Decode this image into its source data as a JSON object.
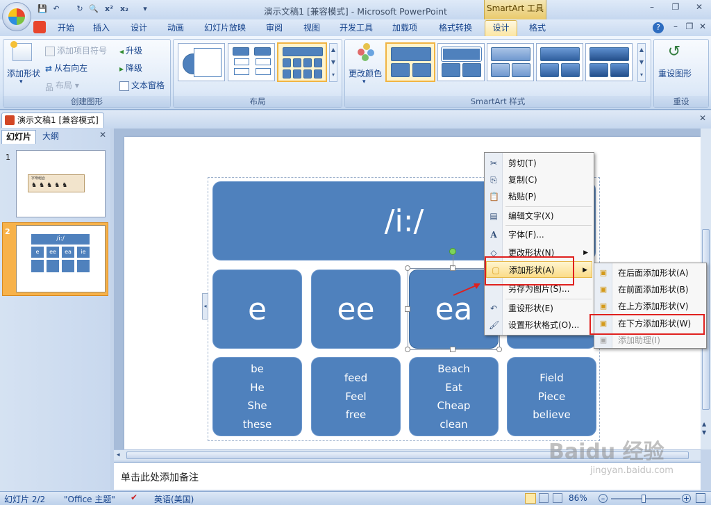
{
  "window": {
    "title": "演示文稿1 [兼容模式] - Microsoft PowerPoint",
    "contextual_tab_group": "SmartArt 工具"
  },
  "tabs": [
    "开始",
    "插入",
    "设计",
    "动画",
    "幻灯片放映",
    "审阅",
    "视图",
    "开发工具",
    "加载项",
    "格式转换",
    "设计",
    "格式"
  ],
  "ribbon": {
    "create_graphic": {
      "label": "创建图形",
      "add_shape": "添加形状",
      "add_bullet": "添加项目符号",
      "right_to_left": "从右向左",
      "layout": "布局",
      "promote": "升级",
      "demote": "降级",
      "text_pane": "文本窗格"
    },
    "layouts": {
      "label": "布局"
    },
    "styles": {
      "label": "SmartArt 样式",
      "change_colors": "更改颜色"
    },
    "reset": {
      "label": "重设",
      "reset_graphic": "重设图形"
    }
  },
  "document_tab": "演示文稿1 [兼容模式]",
  "left_pane": {
    "tab_slides": "幻灯片",
    "tab_outline": "大纲",
    "slide_numbers": [
      "1",
      "2"
    ],
    "thumb_title": "/i:/",
    "thumb_mid": [
      "e",
      "ee",
      "ea",
      "ie"
    ],
    "thumb1_header": "字母组合"
  },
  "slide": {
    "header": "/i:/",
    "columns": [
      {
        "head": "e",
        "words": [
          "be",
          "He",
          "She",
          "these"
        ]
      },
      {
        "head": "ee",
        "words": [
          "feed",
          "Feel",
          "free"
        ]
      },
      {
        "head": "ea",
        "words": [
          "Beach",
          "Eat",
          "Cheap",
          "clean"
        ]
      },
      {
        "head": "",
        "words": [
          "Field",
          "Piece",
          "believe"
        ]
      }
    ]
  },
  "notes_placeholder": "单击此处添加备注",
  "status": {
    "slide_counter": "幻灯片 2/2",
    "theme": "\"Office 主题\"",
    "language": "英语(美国)",
    "zoom": "86%"
  },
  "context_menu": {
    "items": [
      {
        "label": "剪切(T)",
        "icon": "cut-icon"
      },
      {
        "label": "复制(C)",
        "icon": "copy-icon"
      },
      {
        "label": "粘贴(P)",
        "icon": "paste-icon"
      },
      {
        "label": "编辑文字(X)",
        "icon": "edit-text-icon"
      },
      {
        "label": "字体(F)...",
        "icon": "font-icon"
      },
      {
        "label": "更改形状(N)",
        "icon": "change-shape-icon"
      },
      {
        "label": "添加形状(A)",
        "icon": "add-shape-icon"
      },
      {
        "label": "另存为图片(S)...",
        "icon": ""
      },
      {
        "label": "重设形状(E)",
        "icon": "reset-shape-icon"
      },
      {
        "label": "设置形状格式(O)...",
        "icon": "format-shape-icon"
      }
    ],
    "submenu": [
      {
        "label": "在后面添加形状(A)"
      },
      {
        "label": "在前面添加形状(B)"
      },
      {
        "label": "在上方添加形状(V)"
      },
      {
        "label": "在下方添加形状(W)"
      },
      {
        "label": "添加助理(I)"
      }
    ]
  },
  "watermark": {
    "brand": "Baidu 经验",
    "url": "jingyan.baidu.com"
  },
  "colors": {
    "smartart_blue": "#4f81bd",
    "highlight_red": "#e0201e",
    "menu_highlight": "#fbdc88"
  }
}
